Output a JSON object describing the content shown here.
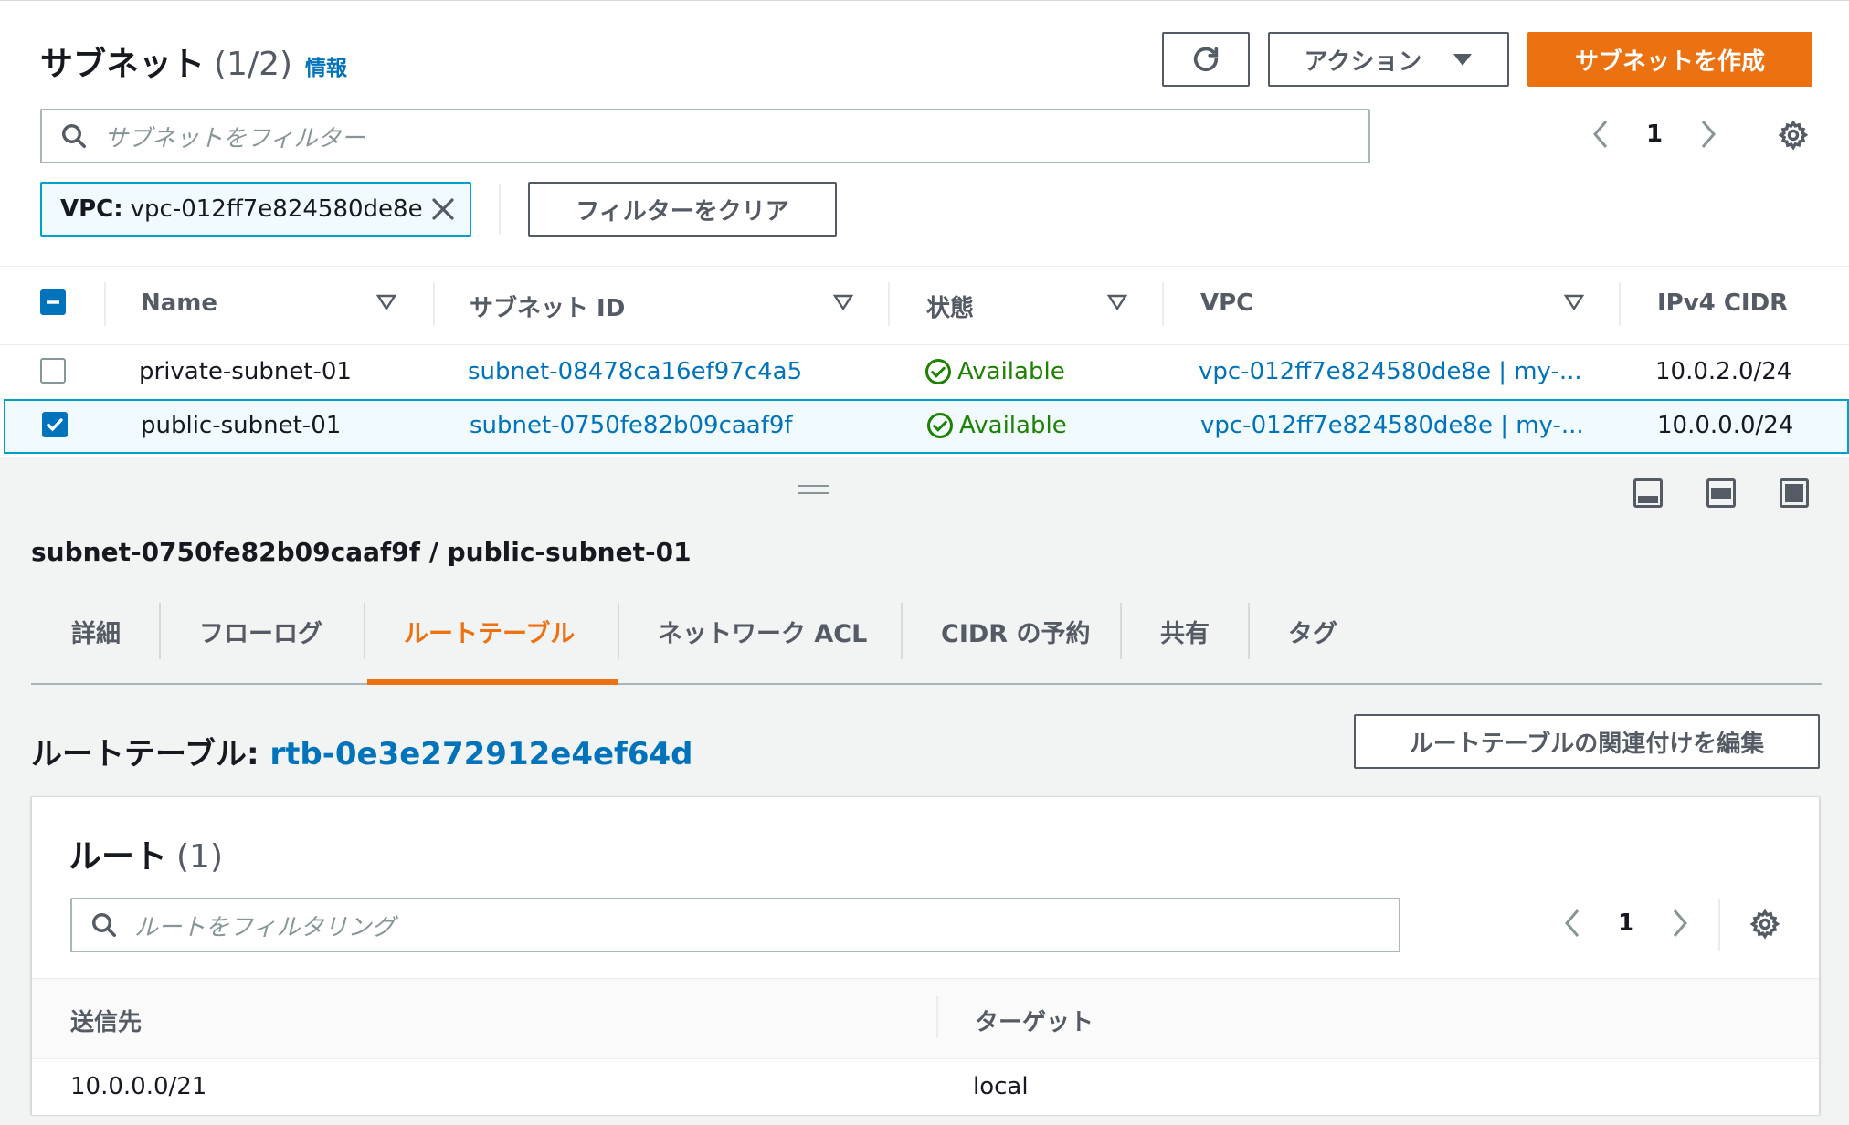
{
  "header": {
    "title": "サブネット",
    "count": "(1/2)",
    "info_link": "情報",
    "actions_label": "アクション",
    "create_label": "サブネットを作成"
  },
  "filter": {
    "placeholder": "サブネットをフィルター",
    "token_key": "VPC:",
    "token_value": "vpc-012ff7e824580de8e",
    "clear_label": "フィルターをクリア"
  },
  "pagination": {
    "page": "1"
  },
  "table": {
    "columns": [
      "Name",
      "サブネット ID",
      "状態",
      "VPC",
      "IPv4 CIDR"
    ],
    "rows": [
      {
        "name": "private-subnet-01",
        "subnet_id": "subnet-08478ca16ef97c4a5",
        "state": "Available",
        "vpc": "vpc-012ff7e824580de8e | my-...",
        "cidr": "10.0.2.0/24",
        "selected": false
      },
      {
        "name": "public-subnet-01",
        "subnet_id": "subnet-0750fe82b09caaf9f",
        "state": "Available",
        "vpc": "vpc-012ff7e824580de8e | my-...",
        "cidr": "10.0.0.0/24",
        "selected": true
      }
    ]
  },
  "detail": {
    "title": "subnet-0750fe82b09caaf9f / public-subnet-01",
    "tabs": [
      {
        "label": "詳細"
      },
      {
        "label": "フローログ"
      },
      {
        "label": "ルートテーブル"
      },
      {
        "label": "ネットワーク ACL"
      },
      {
        "label": "CIDR の予約"
      },
      {
        "label": "共有"
      },
      {
        "label": "タグ"
      }
    ],
    "active_tab": "ルートテーブル",
    "route_table_label": "ルートテーブル:",
    "route_table_id": "rtb-0e3e272912e4ef64d",
    "edit_assoc_label": "ルートテーブルの関連付けを編集",
    "routes": {
      "title": "ルート",
      "count": "(1)",
      "filter_placeholder": "ルートをフィルタリング",
      "page": "1",
      "columns": [
        "送信先",
        "ターゲット"
      ],
      "rows": [
        {
          "destination": "10.0.0.0/21",
          "target": "local"
        }
      ]
    }
  },
  "colors": {
    "accent": "#ec7211",
    "link": "#0073bb",
    "success": "#1d8102",
    "selected_bg": "#f1faff",
    "selected_border": "#00a1c9"
  }
}
